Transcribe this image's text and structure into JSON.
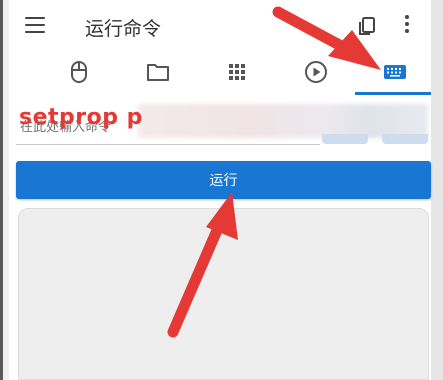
{
  "app": {
    "title": "运行命令"
  },
  "tabs": [
    {
      "id": "mouse",
      "icon": "mouse-icon"
    },
    {
      "id": "folder",
      "icon": "folder-icon"
    },
    {
      "id": "apps",
      "icon": "grid-icon"
    },
    {
      "id": "play",
      "icon": "play-icon"
    },
    {
      "id": "keyboard",
      "icon": "keyboard-icon",
      "selected": true
    }
  ],
  "command": {
    "value": "setprop p",
    "placeholder": "在此处输入命令"
  },
  "run_button": {
    "label": "运行"
  },
  "colors": {
    "accent": "#1976d2",
    "annotation": "#e53935"
  }
}
